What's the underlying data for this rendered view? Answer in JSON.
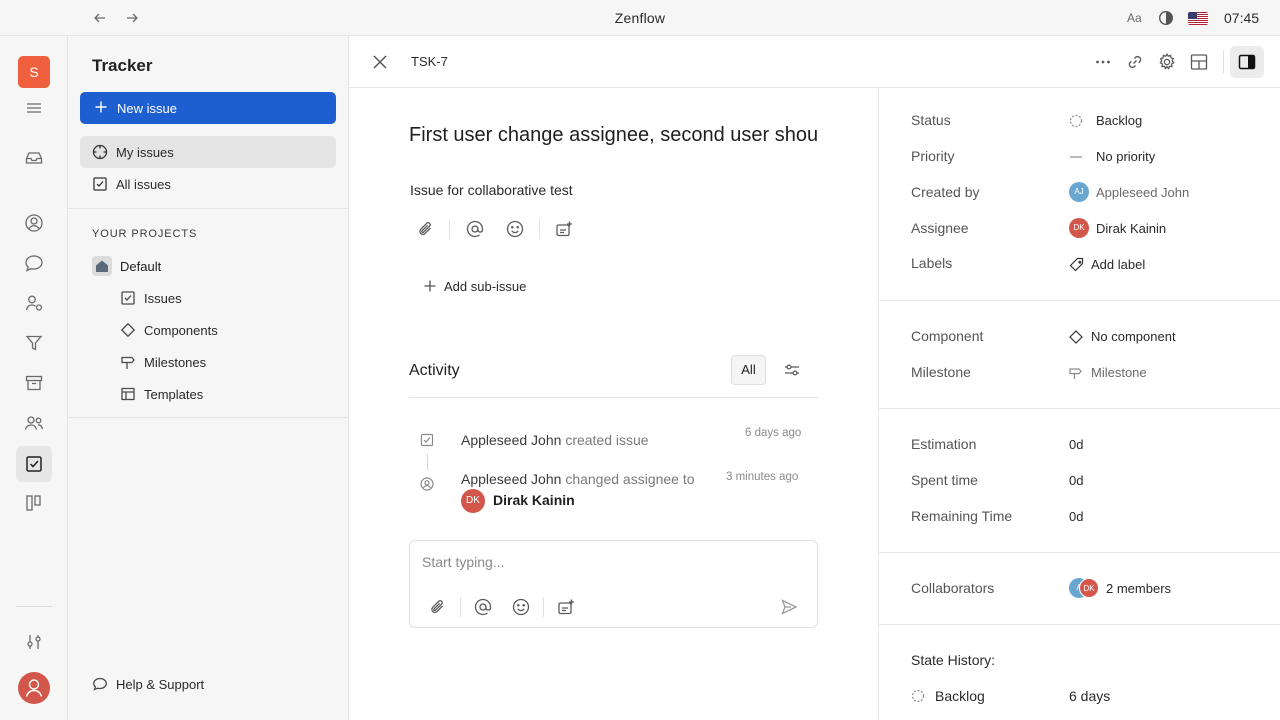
{
  "app": {
    "title": "Zenflow",
    "font_size_label": "Aa",
    "time": "07:45",
    "language_flag": "us-flag-icon"
  },
  "rail": {
    "workspace_initial": "S"
  },
  "sidebar": {
    "title": "Tracker",
    "new_issue_label": "New issue",
    "items": [
      {
        "label": "My issues",
        "icon": "my-issues-icon",
        "active": true
      },
      {
        "label": "All issues",
        "icon": "all-issues-icon",
        "active": false
      }
    ],
    "projects_header": "YOUR PROJECTS",
    "project": {
      "name": "Default",
      "children": [
        {
          "label": "Issues",
          "icon": "issues-icon"
        },
        {
          "label": "Components",
          "icon": "components-icon"
        },
        {
          "label": "Milestones",
          "icon": "milestones-icon"
        },
        {
          "label": "Templates",
          "icon": "templates-icon"
        }
      ]
    },
    "help_label": "Help & Support"
  },
  "issue": {
    "id": "TSK-7",
    "title": "First user change assignee, second user shoul",
    "description": "Issue for collaborative test",
    "add_subissue_label": "Add sub-issue"
  },
  "activity": {
    "title": "Activity",
    "filter_label": "All",
    "entries": [
      {
        "user": "Appleseed John",
        "action": "created issue",
        "time": "6 days ago"
      },
      {
        "user": "Appleseed John",
        "action": "changed assignee to",
        "target_initials": "DK",
        "target": "Dirak Kainin",
        "time": "3 minutes ago"
      }
    ],
    "comment_placeholder": "Start typing..."
  },
  "details": {
    "status": {
      "label": "Status",
      "value": "Backlog"
    },
    "priority": {
      "label": "Priority",
      "value": "No priority"
    },
    "created_by": {
      "label": "Created by",
      "value": "Appleseed John",
      "initials": "AJ"
    },
    "assignee": {
      "label": "Assignee",
      "value": "Dirak Kainin",
      "initials": "DK"
    },
    "labels": {
      "label": "Labels",
      "value": "Add label"
    },
    "component": {
      "label": "Component",
      "value": "No component"
    },
    "milestone": {
      "label": "Milestone",
      "value": "Milestone"
    },
    "estimation": {
      "label": "Estimation",
      "value": "0d"
    },
    "spent_time": {
      "label": "Spent time",
      "value": "0d"
    },
    "remaining_time": {
      "label": "Remaining Time",
      "value": "0d"
    },
    "collaborators": {
      "label": "Collaborators",
      "value": "2 members",
      "initials": [
        "A",
        "DK"
      ]
    },
    "state_history": {
      "label": "State History:",
      "state": "Backlog",
      "duration": "6 days"
    }
  },
  "colors": {
    "accent": "#1d5fd0",
    "workspace": "#f0603f",
    "avatar_dk": "#d2574a",
    "avatar_aj": "#6aa7d0"
  }
}
